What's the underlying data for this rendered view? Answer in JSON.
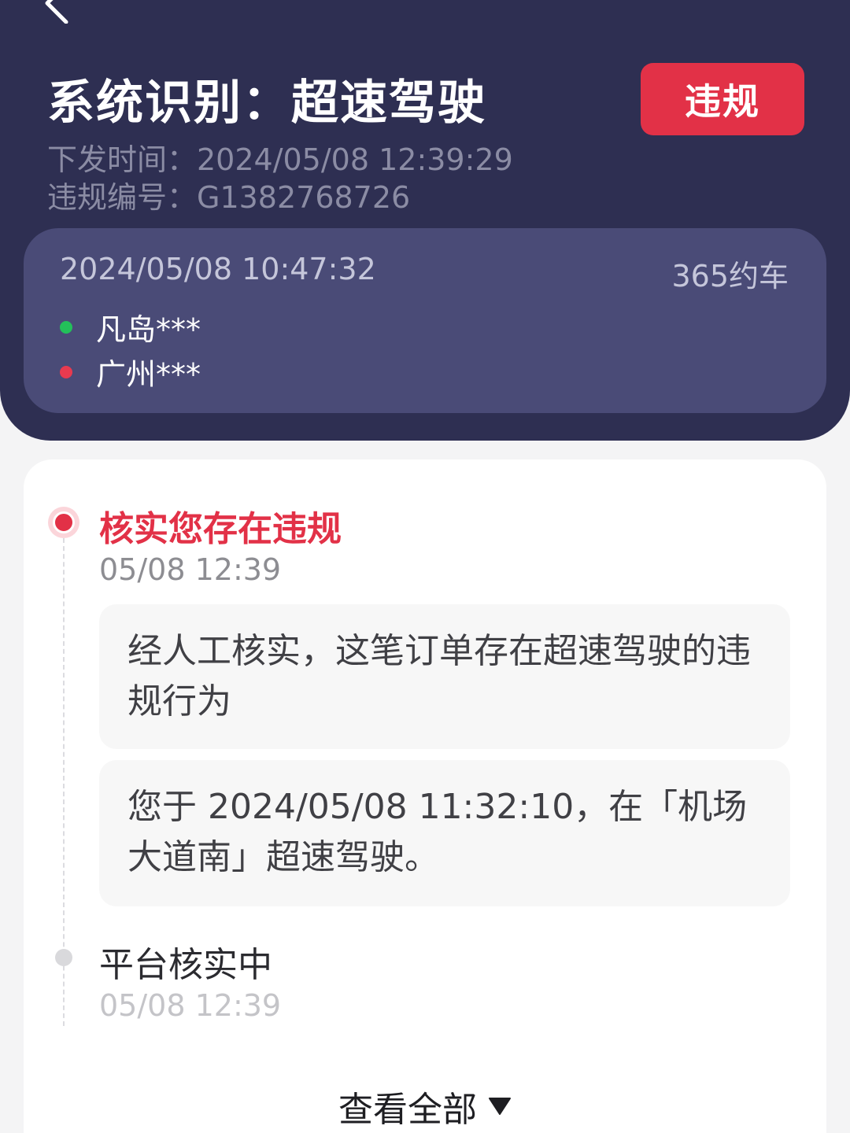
{
  "header": {
    "title": "系统识别：超速驾驶",
    "status_badge": "违规",
    "issue_time": "下发时间：2024/05/08 12:39:29",
    "violation_no": "违规编号：G1382768726"
  },
  "trip": {
    "time": "2024/05/08 10:47:32",
    "platform": "365约车",
    "from": "凡岛***",
    "to": "广州***"
  },
  "timeline": {
    "steps": [
      {
        "title": "核实您存在违规",
        "time": "05/08 12:39",
        "notes": [
          "经人工核实，这笔订单存在超速驾驶的违规行为",
          "您于 2024/05/08 11:32:10，在「机场大道南」超速驾驶。"
        ]
      },
      {
        "title": "平台核实中",
        "time": "05/08 12:39"
      }
    ],
    "view_all_label": "查看全部"
  },
  "colors": {
    "header_bg": "#2e2f52",
    "trip_card_bg": "#4a4b77",
    "accent_red": "#e23147",
    "start_dot": "#23c05a",
    "end_dot": "#e83a4f"
  },
  "icons": {
    "back": "chevron-left-icon",
    "expand": "caret-down-icon"
  }
}
